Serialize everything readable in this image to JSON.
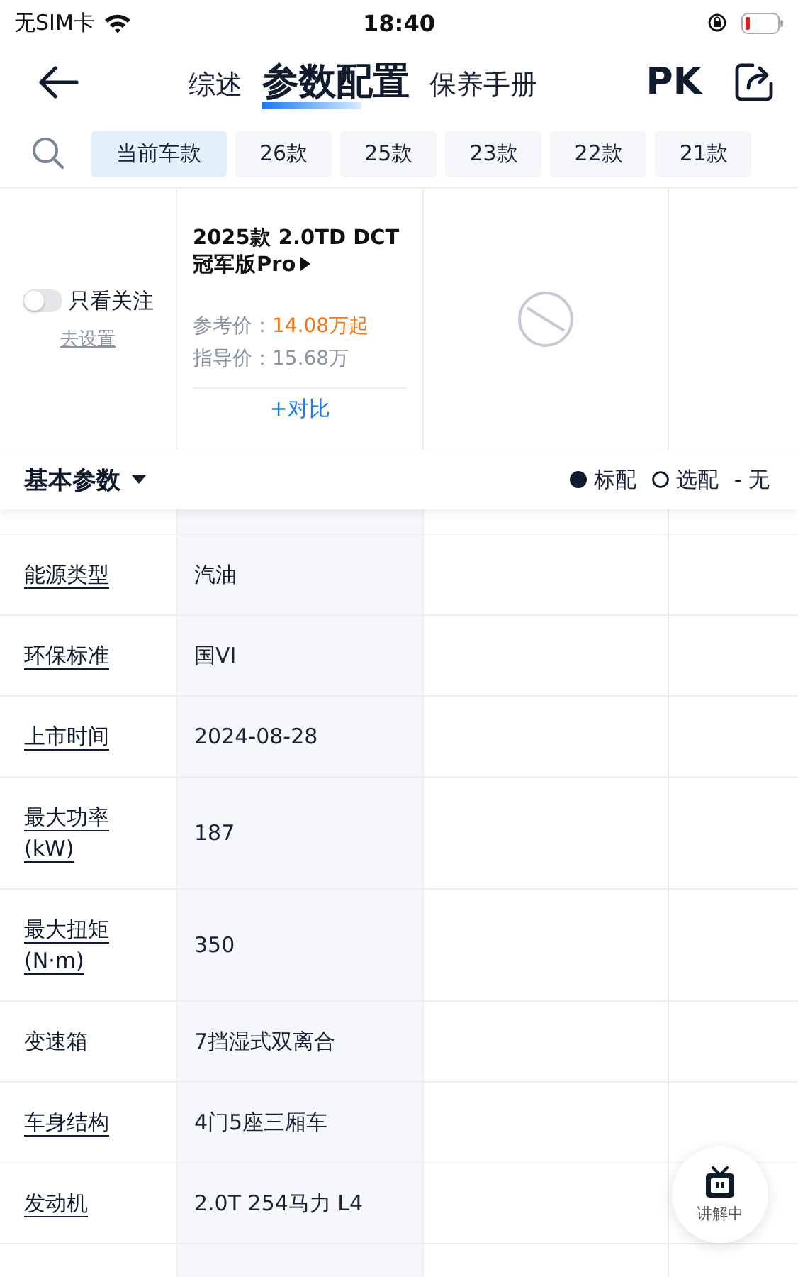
{
  "status_bar": {
    "carrier": "无SIM卡",
    "time": "18:40"
  },
  "nav": {
    "tabs": [
      {
        "label": "综述",
        "selected": false
      },
      {
        "label": "参数配置",
        "selected": true
      },
      {
        "label": "保养手册",
        "selected": false
      }
    ],
    "pk": "PK"
  },
  "year_tabs": [
    {
      "label": "当前车款",
      "selected": true
    },
    {
      "label": "26款",
      "selected": false
    },
    {
      "label": "25款",
      "selected": false
    },
    {
      "label": "23款",
      "selected": false
    },
    {
      "label": "22款",
      "selected": false
    },
    {
      "label": "21款",
      "selected": false
    }
  ],
  "header": {
    "follow_toggle": {
      "label": "只看关注",
      "on": false
    },
    "settings_link": "去设置",
    "car": {
      "name": "2025款 2.0TD DCT 冠军版Pro",
      "ref_label": "参考价：",
      "ref_price": "14.08万起",
      "guide_label": "指导价：",
      "guide_price": "15.68万",
      "compare": "+对比"
    }
  },
  "section": {
    "title": "基本参数",
    "legend": [
      {
        "kind": "filled",
        "label": "标配"
      },
      {
        "kind": "hollow",
        "label": "选配"
      },
      {
        "kind": "dash",
        "label": "- 无"
      }
    ]
  },
  "rows": [
    {
      "label": "能源类型",
      "underlined": true,
      "value": "汽油"
    },
    {
      "label": "环保标准",
      "underlined": true,
      "value": "国VI"
    },
    {
      "label": "上市时间",
      "underlined": true,
      "value": "2024-08-28"
    },
    {
      "label": "最大功率(kW)",
      "underlined": true,
      "value": "187"
    },
    {
      "label": "最大扭矩(N·m)",
      "underlined": true,
      "value": "350"
    },
    {
      "label": "变速箱",
      "underlined": false,
      "value": "7挡湿式双离合"
    },
    {
      "label": "车身结构",
      "underlined": true,
      "value": "4门5座三厢车"
    },
    {
      "label": "发动机",
      "underlined": true,
      "value": "2.0T 254马力 L4"
    }
  ],
  "float_button": {
    "label": "讲解中"
  }
}
